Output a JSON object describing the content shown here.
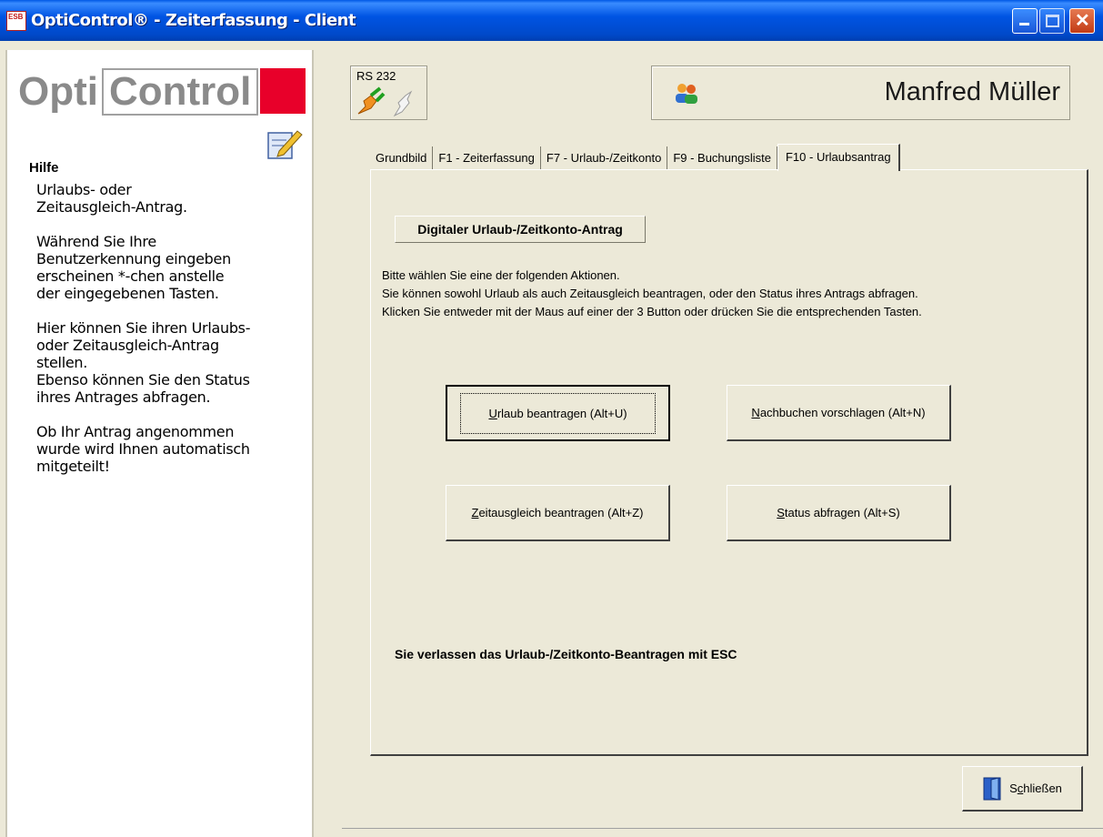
{
  "window": {
    "title": "OptiControl® - Zeiterfassung - Client",
    "app_icon_text": "ESB"
  },
  "sidebar": {
    "logo": {
      "left": "Opti",
      "right": "Control"
    },
    "help_title": "Hilfe",
    "paragraphs": [
      "Urlaubs- oder\nZeitausgleich-Antrag.",
      "Während Sie Ihre\nBenutzerkennung eingeben\nerscheinen *-chen anstelle\nder eingegebenen Tasten.",
      "Hier können Sie ihren Urlaubs-\noder Zeitausgleich-Antrag\nstellen.\nEbenso können Sie den Status\nihres Antrages abfragen.",
      "Ob Ihr Antrag angenommen\nwurde wird Ihnen automatisch\nmitgeteilt!"
    ]
  },
  "header": {
    "rs232_label": "RS 232",
    "user_name": "Manfred Müller"
  },
  "tabs": [
    {
      "label": "Grundbild"
    },
    {
      "label": "F1 - Zeiterfassung"
    },
    {
      "label": "F7 - Urlaub-/Zeitkonto"
    },
    {
      "label": "F9 - Buchungsliste"
    },
    {
      "label": "F10 - Urlaubsantrag",
      "active": true
    }
  ],
  "panel": {
    "title": "Digitaler Urlaub-/Zeitkonto-Antrag",
    "instructions": [
      "Bitte wählen Sie eine der folgenden Aktionen.",
      "Sie können sowohl Urlaub als auch Zeitausgleich beantragen, oder den Status ihres Antrags abfragen.",
      "Klicken Sie entweder mit der Maus auf einer der 3 Button oder drücken Sie die entsprechenden Tasten."
    ],
    "buttons": {
      "urlaub": {
        "mnemonic": "U",
        "rest": "rlaub beantragen (Alt+U)"
      },
      "nachbuchen": {
        "mnemonic": "N",
        "rest": "achbuchen vorschlagen (Alt+N)"
      },
      "zeitausgleich": {
        "mnemonic": "Z",
        "rest": "eitausgleich beantragen (Alt+Z)"
      },
      "status": {
        "mnemonic": "S",
        "rest": "tatus abfragen (Alt+S)"
      }
    },
    "esc_note": "Sie verlassen das Urlaub-/Zeitkonto-Beantragen mit ESC"
  },
  "footer": {
    "close": {
      "pre": "S",
      "mnemonic": "c",
      "rest": "hließen"
    }
  },
  "colors": {
    "titlebar": "#0054e3",
    "logo_red": "#e8002a",
    "window_bg": "#ece9d8"
  }
}
